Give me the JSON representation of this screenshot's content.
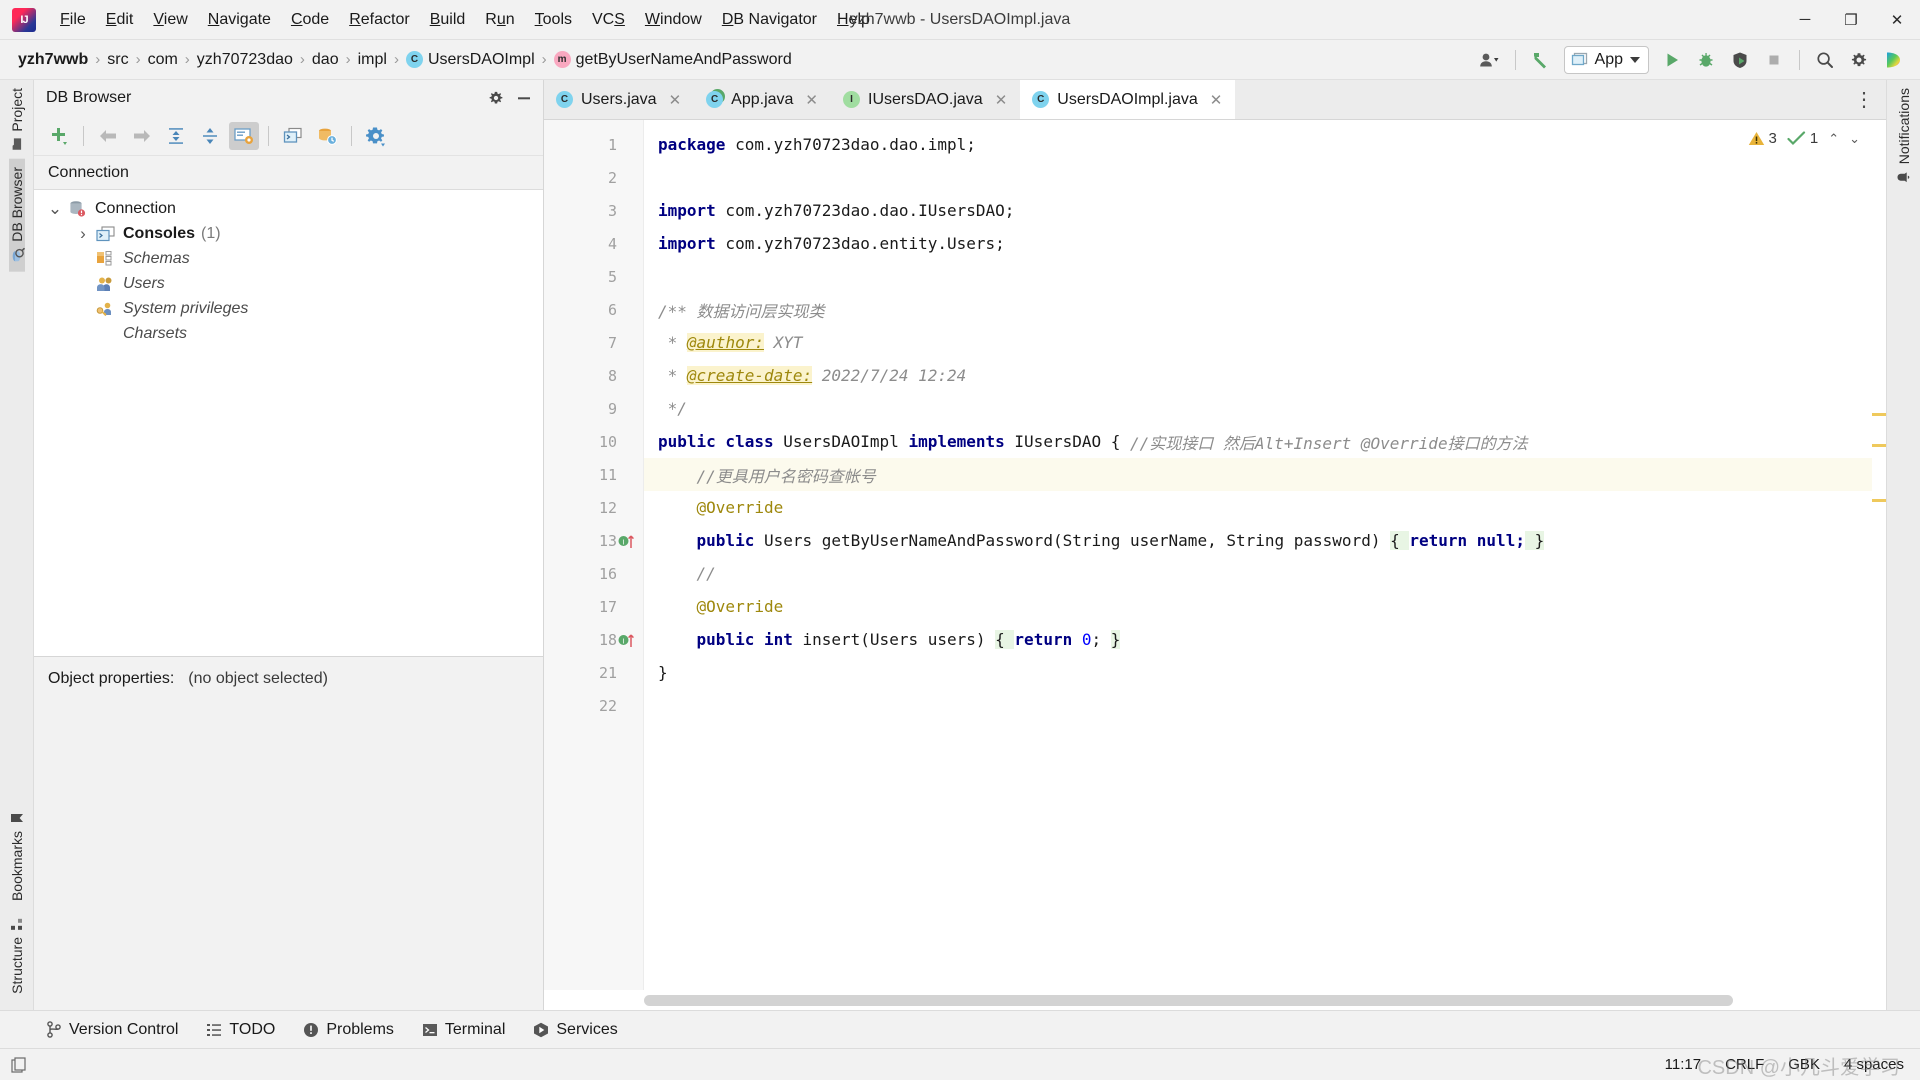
{
  "window": {
    "title": "yzh7wwb - UsersDAOImpl.java",
    "minimize_label": "─",
    "maximize_label": "❐",
    "close_label": "✕"
  },
  "menubar": {
    "items": [
      {
        "label": "File",
        "mnemonic": "F"
      },
      {
        "label": "Edit",
        "mnemonic": "E"
      },
      {
        "label": "View",
        "mnemonic": "V"
      },
      {
        "label": "Navigate",
        "mnemonic": "N"
      },
      {
        "label": "Code",
        "mnemonic": "C"
      },
      {
        "label": "Refactor",
        "mnemonic": "R"
      },
      {
        "label": "Build",
        "mnemonic": "B"
      },
      {
        "label": "Run",
        "mnemonic": "u"
      },
      {
        "label": "Tools",
        "mnemonic": "T"
      },
      {
        "label": "VCS",
        "mnemonic": "S"
      },
      {
        "label": "Window",
        "mnemonic": "W"
      },
      {
        "label": "DB Navigator",
        "mnemonic": "D"
      },
      {
        "label": "Help",
        "mnemonic": "H"
      }
    ]
  },
  "breadcrumb": {
    "separator": "›",
    "items": [
      {
        "label": "yzh7wwb",
        "kind": "project"
      },
      {
        "label": "src",
        "kind": "folder"
      },
      {
        "label": "com",
        "kind": "folder"
      },
      {
        "label": "yzh70723dao",
        "kind": "folder"
      },
      {
        "label": "dao",
        "kind": "folder"
      },
      {
        "label": "impl",
        "kind": "folder"
      },
      {
        "label": "UsersDAOImpl",
        "kind": "class",
        "badge": "C"
      },
      {
        "label": "getByUserNameAndPassword",
        "kind": "method",
        "badge": "m"
      }
    ]
  },
  "toolbar": {
    "run_config": "App",
    "icons": [
      {
        "name": "user-account-icon",
        "glyph": "user"
      },
      {
        "name": "build-hammer-icon",
        "glyph": "hammer"
      },
      {
        "name": "run-icon",
        "glyph": "play"
      },
      {
        "name": "debug-icon",
        "glyph": "bug"
      },
      {
        "name": "run-coverage-icon",
        "glyph": "coverage"
      },
      {
        "name": "stop-icon",
        "glyph": "stop"
      },
      {
        "name": "search-everywhere-icon",
        "glyph": "search"
      },
      {
        "name": "settings-gear-icon",
        "glyph": "gear"
      },
      {
        "name": "ide-assistant-icon",
        "glyph": "assistant"
      }
    ]
  },
  "left_stripe": {
    "top": [
      {
        "label": "Project",
        "icon": "project-folder-icon",
        "active": false
      },
      {
        "label": "DB Browser",
        "icon": "db-browser-icon",
        "active": true
      }
    ],
    "bottom": [
      {
        "label": "Bookmarks",
        "icon": "bookmark-icon",
        "active": false
      },
      {
        "label": "Structure",
        "icon": "structure-icon",
        "active": false
      }
    ]
  },
  "right_stripe": {
    "items": [
      {
        "label": "Notifications",
        "icon": "notifications-bell-icon",
        "active": false
      }
    ]
  },
  "db_browser": {
    "title": "DB Browser",
    "header_actions": [
      {
        "name": "settings-gear-icon",
        "glyph": "gear"
      },
      {
        "name": "hide-minimize-icon",
        "glyph": "minus"
      }
    ],
    "toolbar_buttons": [
      {
        "name": "add-connection-button",
        "glyph": "plus"
      },
      {
        "name": "navigate-back-button",
        "glyph": "arrow-left"
      },
      {
        "name": "navigate-forward-button",
        "glyph": "arrow-right"
      },
      {
        "name": "expand-all-button",
        "glyph": "expand"
      },
      {
        "name": "collapse-all-button",
        "glyph": "collapse"
      },
      {
        "name": "show-object-properties-button",
        "glyph": "props",
        "selected": true
      },
      {
        "name": "open-sql-console-button",
        "glyph": "console"
      },
      {
        "name": "database-history-button",
        "glyph": "db-clock"
      },
      {
        "name": "db-settings-button",
        "glyph": "settings"
      }
    ],
    "column_header": "Connection",
    "tree": [
      {
        "label": "Connection",
        "icon": "database-error-icon",
        "depth": 0,
        "expanded": true,
        "style": "normal",
        "count": null
      },
      {
        "label": "Consoles",
        "icon": "console-icon",
        "depth": 1,
        "expanded": false,
        "style": "bold",
        "count": "(1)"
      },
      {
        "label": "Schemas",
        "icon": "schemas-icon",
        "depth": 1,
        "expanded": null,
        "style": "italic",
        "count": null
      },
      {
        "label": "Users",
        "icon": "users-icon",
        "depth": 1,
        "expanded": null,
        "style": "italic",
        "count": null
      },
      {
        "label": "System privileges",
        "icon": "privileges-key-icon",
        "depth": 1,
        "expanded": null,
        "style": "italic",
        "count": null
      },
      {
        "label": "Charsets",
        "icon": "charsets-icon",
        "depth": 1,
        "expanded": null,
        "style": "italic",
        "count": null
      }
    ],
    "object_properties_label": "Object properties:",
    "object_properties_value": "(no object selected)"
  },
  "editor": {
    "tabs": [
      {
        "label": "Users.java",
        "badge": "C",
        "badge_kind": "class",
        "active": false,
        "close": "✕"
      },
      {
        "label": "App.java",
        "badge": "C",
        "badge_kind": "class-run",
        "active": false,
        "close": "✕"
      },
      {
        "label": "IUsersDAO.java",
        "badge": "I",
        "badge_kind": "interface",
        "active": false,
        "close": "✕"
      },
      {
        "label": "UsersDAOImpl.java",
        "badge": "C",
        "badge_kind": "class",
        "active": true,
        "close": "✕"
      }
    ],
    "tabbar_more": "⋮",
    "inspections": {
      "warning_count": "3",
      "checkmark_count": "1",
      "up_arrow": "⌃",
      "down_arrow": "⌄"
    },
    "line_numbers": [
      "1",
      "2",
      "3",
      "4",
      "5",
      "6",
      "7",
      "8",
      "9",
      "10",
      "11",
      "12",
      "13",
      "16",
      "17",
      "18",
      "21",
      "22"
    ],
    "current_line_index": 10,
    "code_lines": [
      {
        "n": "1",
        "tokens": [
          {
            "t": "package",
            "c": "kw"
          },
          {
            "t": " com.yzh70723dao.dao.impl;",
            "c": "pl"
          }
        ]
      },
      {
        "n": "2",
        "tokens": []
      },
      {
        "n": "3",
        "tokens": [
          {
            "t": "import",
            "c": "kw"
          },
          {
            "t": " com.yzh70723dao.dao.IUsersDAO;",
            "c": "pl"
          }
        ],
        "fold": "minus"
      },
      {
        "n": "4",
        "tokens": [
          {
            "t": "import",
            "c": "kw"
          },
          {
            "t": " com.yzh70723dao.entity.Users;",
            "c": "pl"
          }
        ],
        "fold": "end"
      },
      {
        "n": "5",
        "tokens": []
      },
      {
        "n": "6",
        "tokens": [
          {
            "t": "/** 数据访问层实现类",
            "c": "jd"
          }
        ],
        "fold": "minus"
      },
      {
        "n": "7",
        "tokens": [
          {
            "t": " * ",
            "c": "jd"
          },
          {
            "t": "@author:",
            "c": "tag"
          },
          {
            "t": " XYT",
            "c": "jd"
          }
        ]
      },
      {
        "n": "8",
        "tokens": [
          {
            "t": " * ",
            "c": "jd"
          },
          {
            "t": "@create-date:",
            "c": "tag"
          },
          {
            "t": " 2022/7/24 12:24",
            "c": "jd"
          }
        ]
      },
      {
        "n": "9",
        "tokens": [
          {
            "t": " */",
            "c": "jd"
          }
        ],
        "fold": "end"
      },
      {
        "n": "10",
        "tokens": [
          {
            "t": "public class",
            "c": "kw"
          },
          {
            "t": " UsersDAOImpl ",
            "c": "typ"
          },
          {
            "t": "implements",
            "c": "kw"
          },
          {
            "t": " IUsersDAO { ",
            "c": "typ"
          },
          {
            "t": "//实现接口 然后Alt+Insert @Override接口的方法",
            "c": "cm"
          }
        ]
      },
      {
        "n": "11",
        "tokens": [
          {
            "t": "    //更具用户名密码查帐号",
            "c": "cm"
          }
        ],
        "current": true
      },
      {
        "n": "12",
        "tokens": [
          {
            "t": "    @Override",
            "c": "an"
          }
        ]
      },
      {
        "n": "13",
        "tokens": [
          {
            "t": "    ",
            "c": "pl"
          },
          {
            "t": "public",
            "c": "kw"
          },
          {
            "t": " Users getByUserNameAndPassword(String userName, String password) ",
            "c": "pl"
          },
          {
            "t": "{ ",
            "c": "hl"
          },
          {
            "t": "return null;",
            "c": "kw"
          },
          {
            "t": " }",
            "c": "hl"
          }
        ],
        "gutter_mark": "impl",
        "fold": "plus"
      },
      {
        "n": "16",
        "tokens": [
          {
            "t": "    //",
            "c": "cm"
          }
        ]
      },
      {
        "n": "17",
        "tokens": [
          {
            "t": "    @Override",
            "c": "an"
          }
        ]
      },
      {
        "n": "18",
        "tokens": [
          {
            "t": "    ",
            "c": "pl"
          },
          {
            "t": "public int",
            "c": "kw"
          },
          {
            "t": " insert(Users users) ",
            "c": "pl"
          },
          {
            "t": "{ ",
            "c": "hl"
          },
          {
            "t": "return ",
            "c": "kw"
          },
          {
            "t": "0",
            "c": "num0"
          },
          {
            "t": "; ",
            "c": "pl"
          },
          {
            "t": "}",
            "c": "hl"
          }
        ],
        "gutter_mark": "impl",
        "fold": "plus"
      },
      {
        "n": "21",
        "tokens": [
          {
            "t": "}",
            "c": "pl"
          }
        ]
      },
      {
        "n": "22",
        "tokens": []
      }
    ]
  },
  "bottom_bar": {
    "items": [
      {
        "label": "Version Control",
        "icon": "version-control-branch-icon"
      },
      {
        "label": "TODO",
        "icon": "todo-list-icon"
      },
      {
        "label": "Problems",
        "icon": "problems-warning-icon"
      },
      {
        "label": "Terminal",
        "icon": "terminal-icon"
      },
      {
        "label": "Services",
        "icon": "services-play-icon"
      }
    ]
  },
  "status_bar": {
    "left_icon": "copy-files-icon",
    "caret_position": "11:17",
    "line_separator": "CRLF",
    "encoding": "GBK",
    "indent": "4 spaces",
    "watermark": "CSDN @小⼏斗爱学习"
  }
}
